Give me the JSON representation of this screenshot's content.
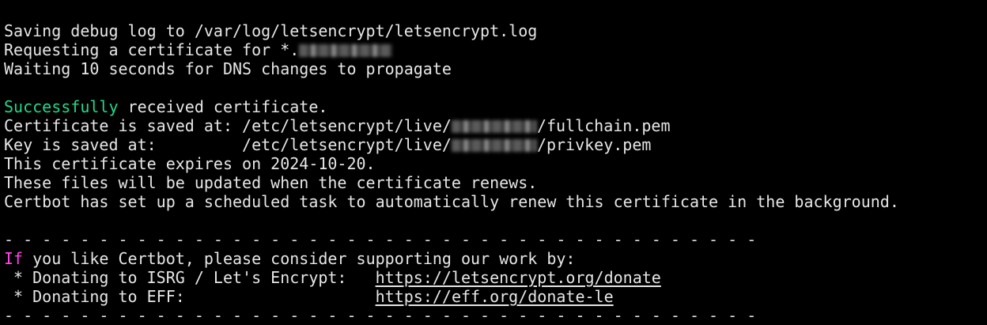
{
  "terminal": {
    "top_fragment": "\"",
    "log_line": "Saving debug log to /var/log/letsencrypt/letsencrypt.log",
    "request_prefix": "Requesting a certificate for *.",
    "waiting_line": "Waiting 10 seconds for DNS changes to propagate",
    "success_word": "Successfully",
    "success_rest": " received certificate.",
    "cert_prefix": "Certificate is saved at: /etc/letsencrypt/live/",
    "cert_suffix": "/fullchain.pem",
    "key_prefix": "Key is saved at:         /etc/letsencrypt/live/",
    "key_suffix": "/privkey.pem",
    "expires_line": "This certificate expires on 2024-10-20.",
    "renew_line": "These files will be updated when the certificate renews.",
    "task_line": "Certbot has set up a scheduled task to automatically renew this certificate in the background.",
    "separator": "- - - - - - - - - - - - - - - - - - - - - - - - - - - - - - - - - - - - - - - -",
    "if_word": "If",
    "support_rest": " you like Certbot, please consider supporting our work by:",
    "donate_isrg_label": " * Donating to ISRG / Let's Encrypt:   ",
    "donate_isrg_link": "https://letsencrypt.org/donate",
    "donate_eff_label": " * Donating to EFF:                    ",
    "donate_eff_link": "https://eff.org/donate-le",
    "colors": {
      "background": "#000000",
      "text": "#e6e6e6",
      "success": "#20d98a",
      "highlight": "#ff43e6"
    }
  }
}
